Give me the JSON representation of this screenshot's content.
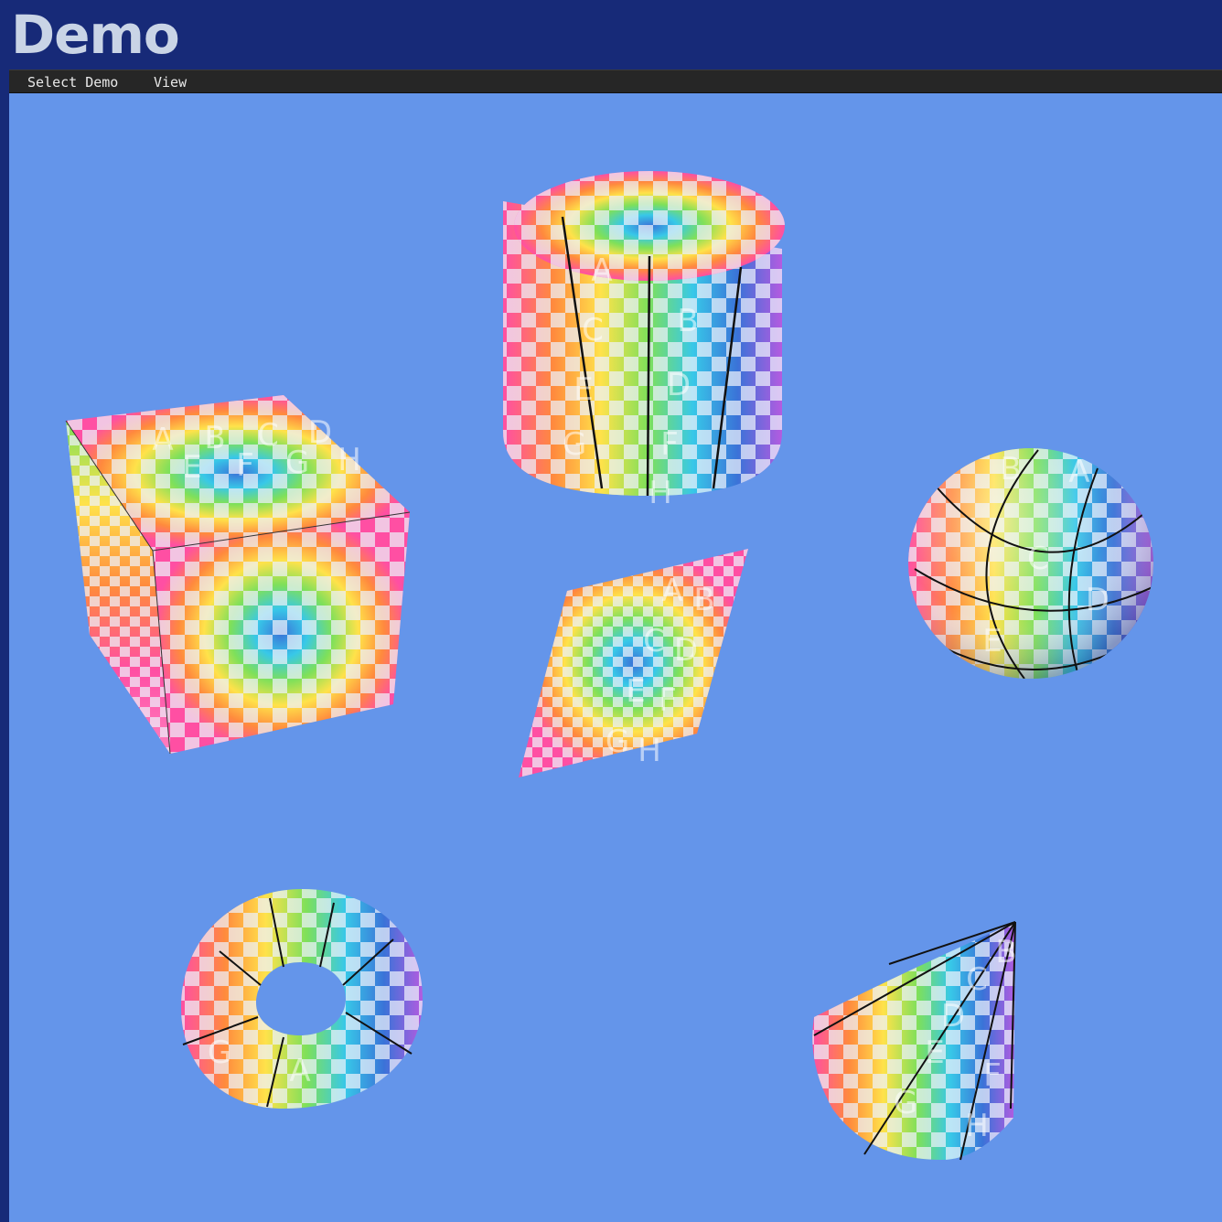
{
  "app": {
    "title": "Demo"
  },
  "menubar": {
    "items": [
      {
        "label": "Select Demo"
      },
      {
        "label": "View"
      }
    ]
  },
  "viewport": {
    "background_color": "#6495ea",
    "objects": [
      {
        "name": "cube",
        "letters": [
          "A",
          "B",
          "C",
          "D",
          "E",
          "F",
          "G",
          "H"
        ]
      },
      {
        "name": "cylinder",
        "letters": [
          "A",
          "B",
          "C",
          "D",
          "E",
          "F",
          "G",
          "H"
        ]
      },
      {
        "name": "sphere",
        "letters": [
          "B",
          "A",
          "C",
          "D",
          "E"
        ]
      },
      {
        "name": "plane",
        "letters": [
          "A",
          "B",
          "C",
          "D",
          "E",
          "F",
          "G",
          "H"
        ]
      },
      {
        "name": "torus",
        "letters": [
          "A",
          "G"
        ]
      },
      {
        "name": "cone",
        "letters": [
          "B",
          "C",
          "D",
          "E",
          "F",
          "G",
          "H"
        ]
      }
    ]
  },
  "colors": {
    "title_bar": "#172a78",
    "menubar": "#262626",
    "texture_checker_light": "#eef2fb",
    "texture_gradient": [
      "#ff4fa3",
      "#ff8a3d",
      "#ffe24a",
      "#7ee05a",
      "#38c8e8",
      "#3a73d8",
      "#b45be0"
    ]
  }
}
